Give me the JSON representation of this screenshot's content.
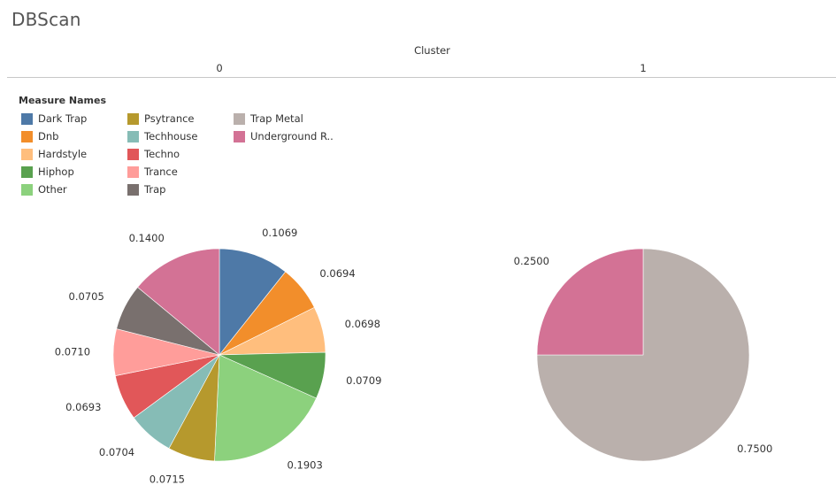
{
  "title": "DBScan",
  "column_header": "Cluster",
  "legend_title": "Measure Names",
  "legend": [
    {
      "label": "Dark Trap",
      "color": "#4e79a7"
    },
    {
      "label": "Dnb",
      "color": "#f28e2b"
    },
    {
      "label": "Hardstyle",
      "color": "#ffbe7d"
    },
    {
      "label": "Hiphop",
      "color": "#59a14f"
    },
    {
      "label": "Other",
      "color": "#8cd17d"
    },
    {
      "label": "Psytrance",
      "color": "#b6992d"
    },
    {
      "label": "Techhouse",
      "color": "#86bcb6"
    },
    {
      "label": "Techno",
      "color": "#e15759"
    },
    {
      "label": "Trance",
      "color": "#ff9d9a"
    },
    {
      "label": "Trap",
      "color": "#79706e"
    },
    {
      "label": "Trap Metal",
      "color": "#bab0ac"
    },
    {
      "label": "Underground R..",
      "color": "#d37295"
    }
  ],
  "chart_data": [
    {
      "type": "pie",
      "cluster": "0",
      "slices": [
        {
          "name": "Dark Trap",
          "value": 0.1069,
          "label": "0.1069"
        },
        {
          "name": "Dnb",
          "value": 0.0694,
          "label": "0.0694"
        },
        {
          "name": "Hardstyle",
          "value": 0.0698,
          "label": "0.0698"
        },
        {
          "name": "Hiphop",
          "value": 0.0709,
          "label": "0.0709"
        },
        {
          "name": "Other",
          "value": 0.1903,
          "label": "0.1903"
        },
        {
          "name": "Psytrance",
          "value": 0.0715,
          "label": "0.0715"
        },
        {
          "name": "Techhouse",
          "value": 0.0704,
          "label": "0.0704"
        },
        {
          "name": "Techno",
          "value": 0.0693,
          "label": "0.0693"
        },
        {
          "name": "Trance",
          "value": 0.071,
          "label": "0.0710"
        },
        {
          "name": "Trap",
          "value": 0.0705,
          "label": "0.0705"
        },
        {
          "name": "Underground R..",
          "value": 0.14,
          "label": "0.1400"
        }
      ]
    },
    {
      "type": "pie",
      "cluster": "1",
      "slices": [
        {
          "name": "Trap Metal",
          "value": 0.75,
          "label": "0.7500"
        },
        {
          "name": "Underground R..",
          "value": 0.25,
          "label": "0.2500"
        }
      ]
    }
  ]
}
